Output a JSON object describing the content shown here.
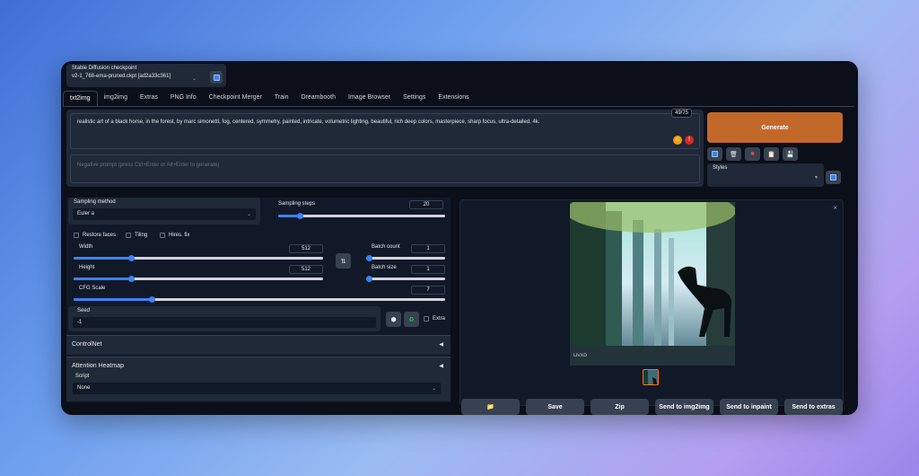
{
  "checkpoint": {
    "label": "Stable Diffusion checkpoint",
    "value": "v2-1_768-ema-pruned.ckpt [ad2a33c361]"
  },
  "tabs": [
    {
      "label": "txt2img"
    },
    {
      "label": "img2img"
    },
    {
      "label": "Extras"
    },
    {
      "label": "PNG Info"
    },
    {
      "label": "Checkpoint Merger"
    },
    {
      "label": "Train"
    },
    {
      "label": "Dreambooth"
    },
    {
      "label": "Image Browser"
    },
    {
      "label": "Settings"
    },
    {
      "label": "Extensions"
    }
  ],
  "prompt": {
    "text": "realistic art of a black horse, in the forest, by marc simonetti, fog, centered, symmetry, painted, intricate, volumetric lighting, beautiful, rich deep colors, masterpiece, sharp focus, ultra-detailed, 4k.",
    "token_count": "49/75",
    "negative_placeholder": "Negative prompt (press Ctrl+Enter or Alt+Enter to generate)"
  },
  "generate_label": "Generate",
  "styles": {
    "label": "Styles",
    "value": ""
  },
  "sampling": {
    "method_label": "Sampling method",
    "method_value": "Euler a",
    "steps_label": "Sampling steps",
    "steps_value": "20"
  },
  "options": {
    "restore_faces": "Restore faces",
    "tiling": "Tiling",
    "hires_fix": "Hires. fix"
  },
  "size": {
    "width_label": "Width",
    "width_value": "512",
    "height_label": "Height",
    "height_value": "512"
  },
  "batch": {
    "count_label": "Batch count",
    "count_value": "1",
    "size_label": "Batch size",
    "size_value": "1"
  },
  "cfg": {
    "label": "CFG Scale",
    "value": "7"
  },
  "seed": {
    "label": "Seed",
    "value": "-1",
    "extra_label": "Extra"
  },
  "accordions": {
    "controlnet": "ControlNet",
    "attention": "Attention Heatmap"
  },
  "script": {
    "label": "Script",
    "value": "None"
  },
  "actions": [
    "Save",
    "Zip",
    "Send to img2img",
    "Send to inpaint",
    "Send to extras"
  ],
  "slider_levels": {
    "steps": 0.13,
    "width": 0.23,
    "height": 0.23,
    "batch_count": 0.0,
    "batch_size": 0.0,
    "cfg": 0.21
  },
  "colors": {
    "accent": "#c2692a",
    "slider": "#3b82f6",
    "bg": "#0b0f19"
  }
}
